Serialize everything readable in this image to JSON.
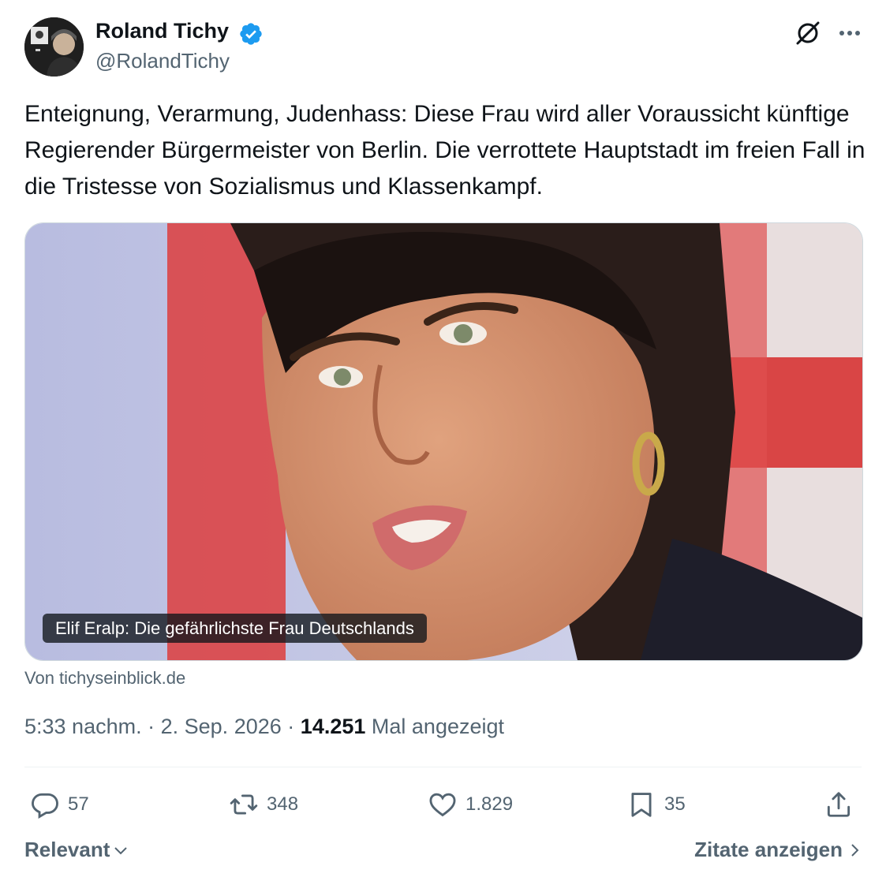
{
  "author": {
    "name": "Roland Tichy",
    "handle": "@RolandTichy"
  },
  "tweet": {
    "text": "Enteignung, Verarmung, Judenhass: Diese Frau wird aller Voraussicht künftige Regierender Bürgermeister von Berlin. Die verrottete Hauptstadt im freien Fall in die Tristesse von Sozialismus und Klassenkampf."
  },
  "media": {
    "caption": "Elif Eralp: Die gefährlichste Frau Deutschlands",
    "source": "Von tichyseinblick.de"
  },
  "meta": {
    "time": "5:33 nachm.",
    "separator": "·",
    "date": "2. Sep. 2026",
    "views": "14.251",
    "views_label": "Mal angezeigt"
  },
  "actions": {
    "replies": "57",
    "reposts": "348",
    "likes": "1.829",
    "bookmarks": "35"
  },
  "footer": {
    "sort_label": "Relevant",
    "quotes_label": "Zitate anzeigen"
  },
  "colors": {
    "verified": "#1d9bf0",
    "text_primary": "#0f1419",
    "text_secondary": "#536471"
  },
  "icons": [
    "verified-badge-icon",
    "grok-icon",
    "more-icon",
    "reply-icon",
    "repost-icon",
    "like-icon",
    "bookmark-icon",
    "share-icon",
    "chevron-down-icon",
    "chevron-right-icon"
  ]
}
